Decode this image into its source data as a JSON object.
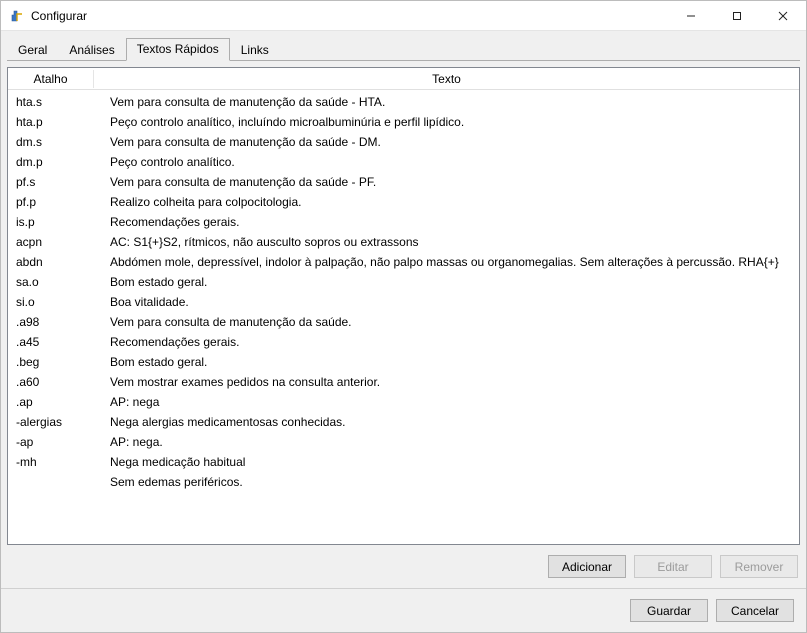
{
  "window": {
    "title": "Configurar"
  },
  "tabs": [
    {
      "label": "Geral",
      "active": false
    },
    {
      "label": "Análises",
      "active": false
    },
    {
      "label": "Textos Rápidos",
      "active": true
    },
    {
      "label": "Links",
      "active": false
    }
  ],
  "table": {
    "headers": {
      "shortcut": "Atalho",
      "text": "Texto"
    },
    "rows": [
      {
        "shortcut": "hta.s",
        "text": "Vem para consulta de manutenção da saúde - HTA."
      },
      {
        "shortcut": "hta.p",
        "text": "Peço controlo analítico, incluíndo microalbuminúria e perfil lipídico."
      },
      {
        "shortcut": "dm.s",
        "text": "Vem para consulta de manutenção da saúde - DM."
      },
      {
        "shortcut": "dm.p",
        "text": "Peço controlo analítico."
      },
      {
        "shortcut": "pf.s",
        "text": "Vem para consulta de manutenção da saúde - PF."
      },
      {
        "shortcut": "pf.p",
        "text": "Realizo colheita para colpocitologia."
      },
      {
        "shortcut": "is.p",
        "text": "Recomendações gerais."
      },
      {
        "shortcut": "acpn",
        "text": "AC: S1{+}S2, rítmicos, não ausculto sopros ou extrassons"
      },
      {
        "shortcut": "abdn",
        "text": "Abdómen mole, depressível, indolor à palpação, não palpo massas ou organomegalias. Sem alterações à percussão. RHA{+}"
      },
      {
        "shortcut": "sa.o",
        "text": "Bom estado geral."
      },
      {
        "shortcut": "si.o",
        "text": "Boa vitalidade."
      },
      {
        "shortcut": ".a98",
        "text": "Vem para consulta de manutenção da saúde."
      },
      {
        "shortcut": ".a45",
        "text": "Recomendações gerais."
      },
      {
        "shortcut": ".beg",
        "text": "Bom estado geral."
      },
      {
        "shortcut": ".a60",
        "text": "Vem mostrar exames pedidos na consulta anterior."
      },
      {
        "shortcut": ".ap",
        "text": "AP: nega"
      },
      {
        "shortcut": "-alergias",
        "text": "Nega alergias medicamentosas conhecidas."
      },
      {
        "shortcut": "-ap",
        "text": "AP: nega."
      },
      {
        "shortcut": "-mh",
        "text": "Nega medicação habitual"
      },
      {
        "shortcut": "",
        "text": "Sem edemas periféricos."
      }
    ]
  },
  "buttons": {
    "add": "Adicionar",
    "edit": "Editar",
    "remove": "Remover",
    "save": "Guardar",
    "cancel": "Cancelar"
  }
}
